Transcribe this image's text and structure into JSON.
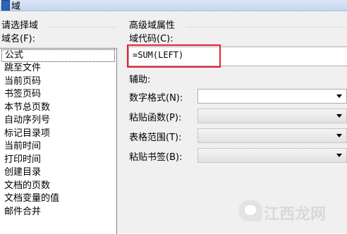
{
  "window": {
    "title": "域"
  },
  "left_group": {
    "heading": "请选择域",
    "field_names_label": "域名(F):",
    "items": [
      "公式",
      "跳至文件",
      "当前页码",
      "书签页码",
      "本节总页数",
      "自动序列号",
      "标记目录项",
      "当前时间",
      "打印时间",
      "创建目录",
      "文档的页数",
      "文档变量的值",
      "邮件合并"
    ],
    "selected_item": "公式"
  },
  "right_group": {
    "heading": "高级域属性",
    "field_code_label": "域代码(C):",
    "field_code_value": "=SUM(LEFT)",
    "helper_label": "辅助:",
    "rows": [
      {
        "label": "数字格式(N):",
        "value": ""
      },
      {
        "label": "粘贴函数(P):",
        "value": ""
      },
      {
        "label": "表格范围(T):",
        "value": ""
      },
      {
        "label": "粘贴书签(B):",
        "value": ""
      }
    ]
  },
  "watermark": {
    "text": "江西龙网"
  },
  "colors": {
    "highlight": "#e8212b",
    "title_bar": "#c4d6ee"
  }
}
